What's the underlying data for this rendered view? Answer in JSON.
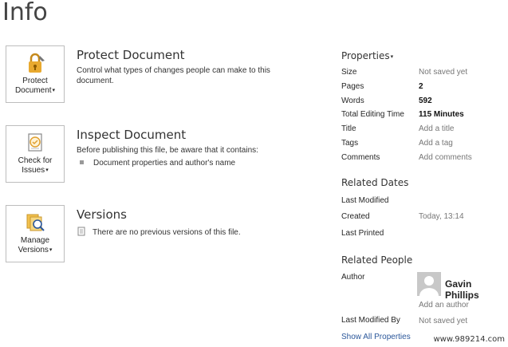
{
  "page": {
    "title": "Info"
  },
  "protect": {
    "button_line1": "Protect",
    "button_line2": "Document",
    "heading": "Protect Document",
    "desc_line1": "Control what types of changes people can make to this",
    "desc_line2": "document."
  },
  "inspect": {
    "button_line1": "Check for",
    "button_line2": "Issues",
    "heading": "Inspect Document",
    "desc": "Before publishing this file, be aware that it contains:",
    "bullet": "Document properties and author's name"
  },
  "versions": {
    "button_line1": "Manage",
    "button_line2": "Versions",
    "heading": "Versions",
    "desc": "There are no previous versions of this file."
  },
  "properties": {
    "heading": "Properties",
    "rows": [
      {
        "label": "Size",
        "value": "Not saved yet"
      },
      {
        "label": "Pages",
        "value": "2"
      },
      {
        "label": "Words",
        "value": "592"
      },
      {
        "label": "Total Editing Time",
        "value": "115 Minutes"
      },
      {
        "label": "Title",
        "value": "Add a title"
      },
      {
        "label": "Tags",
        "value": "Add a tag"
      },
      {
        "label": "Comments",
        "value": "Add comments"
      }
    ]
  },
  "related_dates": {
    "heading": "Related Dates",
    "last_modified": "Last Modified",
    "created": "Created",
    "created_value": "Today, 13:14",
    "last_printed": "Last Printed"
  },
  "related_people": {
    "heading": "Related People",
    "author_label": "Author",
    "author_name": "Gavin Phillips",
    "add_author": "Add an author",
    "last_modified_by_label": "Last Modified By",
    "last_modified_by_value": "Not saved yet"
  },
  "show_all": "Show All Properties",
  "caret": "▾",
  "watermark": "www.989214.com",
  "colors": {
    "link": "#2b579a",
    "lock": "#e8a92f"
  }
}
